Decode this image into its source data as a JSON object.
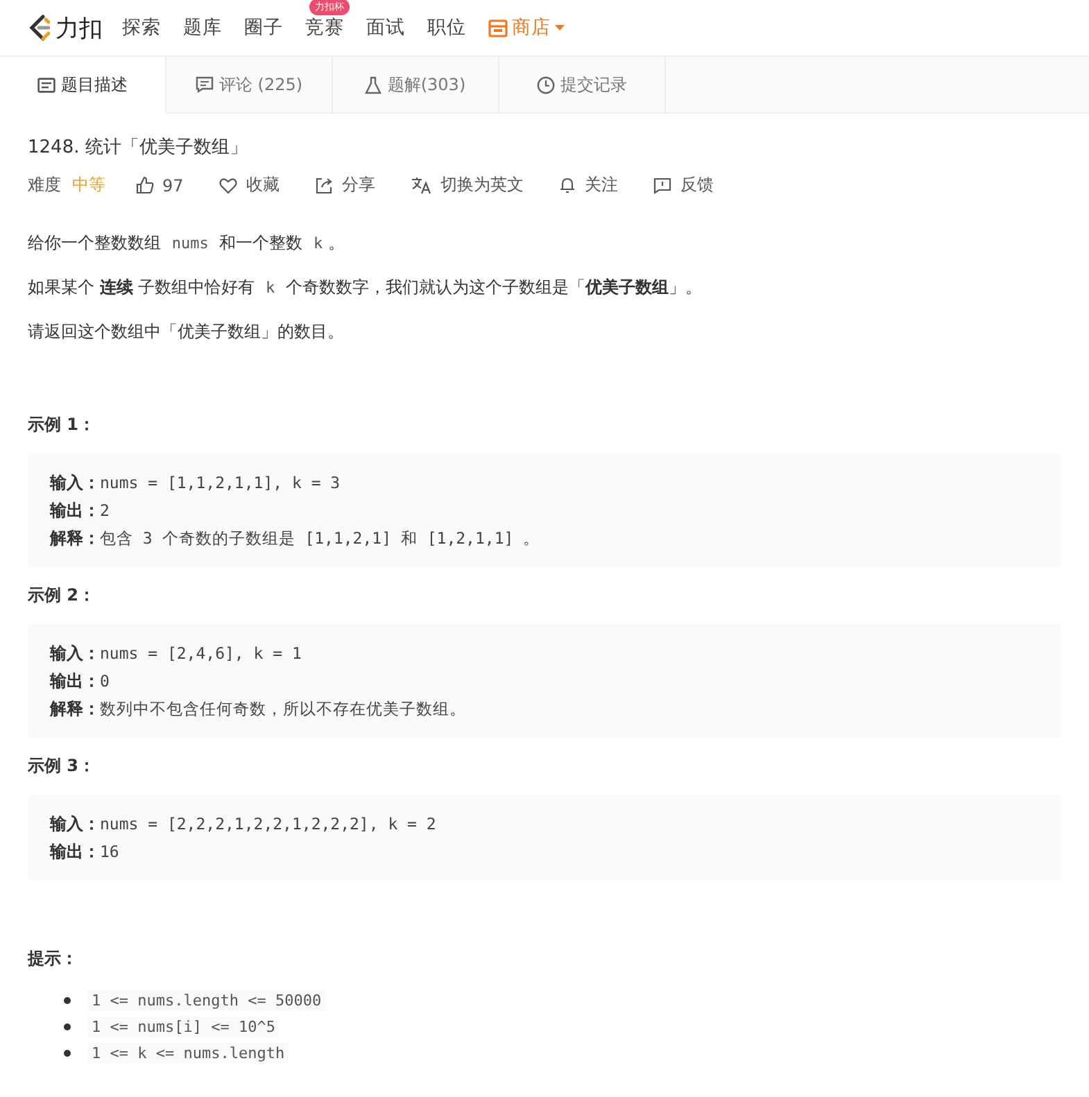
{
  "nav": {
    "logo": "力扣",
    "items": [
      {
        "label": "探索",
        "kind": "link"
      },
      {
        "label": "题库",
        "kind": "link"
      },
      {
        "label": "圈子",
        "kind": "link"
      },
      {
        "label": "竞赛",
        "kind": "link",
        "badge": "力扣杯"
      },
      {
        "label": "面试",
        "kind": "link"
      },
      {
        "label": "职位",
        "kind": "link"
      },
      {
        "label": "商店",
        "kind": "shop"
      }
    ]
  },
  "tabs": [
    {
      "label": "题目描述",
      "selected": true
    },
    {
      "label": "评论 (225)",
      "selected": false
    },
    {
      "label": "题解(303)",
      "selected": false
    },
    {
      "label": "提交记录",
      "selected": false
    }
  ],
  "problem": {
    "title": "1248. 统计「优美子数组」",
    "difficulty_label": "难度",
    "difficulty": "中等",
    "actions": [
      "97",
      "收藏",
      "分享",
      "切换为英文",
      "关注",
      "反馈"
    ]
  },
  "description": [
    [
      {
        "kind": "text",
        "text": "给你一个整数数组 "
      },
      {
        "kind": "code",
        "text": "nums"
      },
      {
        "kind": "text",
        "text": " 和一个整数 "
      },
      {
        "kind": "code",
        "text": "k"
      },
      {
        "kind": "text",
        "text": "。"
      }
    ],
    [
      {
        "kind": "text",
        "text": "如果某个 "
      },
      {
        "kind": "bold",
        "text": "连续"
      },
      {
        "kind": "text",
        "text": " 子数组中恰好有 "
      },
      {
        "kind": "code",
        "text": "k"
      },
      {
        "kind": "text",
        "text": " 个奇数数字，我们就认为这个子数组是「"
      },
      {
        "kind": "bold",
        "text": "优美子数组"
      },
      {
        "kind": "text",
        "text": "」。"
      }
    ],
    [
      {
        "kind": "text",
        "text": "请返回这个数组中「优美子数组」的数目。"
      }
    ]
  ],
  "examples": [
    {
      "title": "示例 1：",
      "lines": [
        {
          "label": "输入：",
          "value": "nums = [1,1,2,1,1], k = 3"
        },
        {
          "label": "输出：",
          "value": "2"
        },
        {
          "label": "解释：",
          "value": "包含 3 个奇数的子数组是 [1,1,2,1] 和 [1,2,1,1] 。"
        }
      ]
    },
    {
      "title": "示例 2：",
      "lines": [
        {
          "label": "输入：",
          "value": "nums = [2,4,6], k = 1"
        },
        {
          "label": "输出：",
          "value": "0"
        },
        {
          "label": "解释：",
          "value": "数列中不包含任何奇数，所以不存在优美子数组。"
        }
      ]
    },
    {
      "title": "示例 3：",
      "lines": [
        {
          "label": "输入：",
          "value": "nums = [2,2,2,1,2,2,1,2,2,2], k = 2"
        },
        {
          "label": "输出：",
          "value": "16"
        }
      ]
    }
  ],
  "hints": {
    "title": "提示：",
    "items": [
      "1 <= nums.length <= 50000",
      "1 <= nums[i] <= 10^5",
      "1 <= k <= nums.length"
    ]
  }
}
